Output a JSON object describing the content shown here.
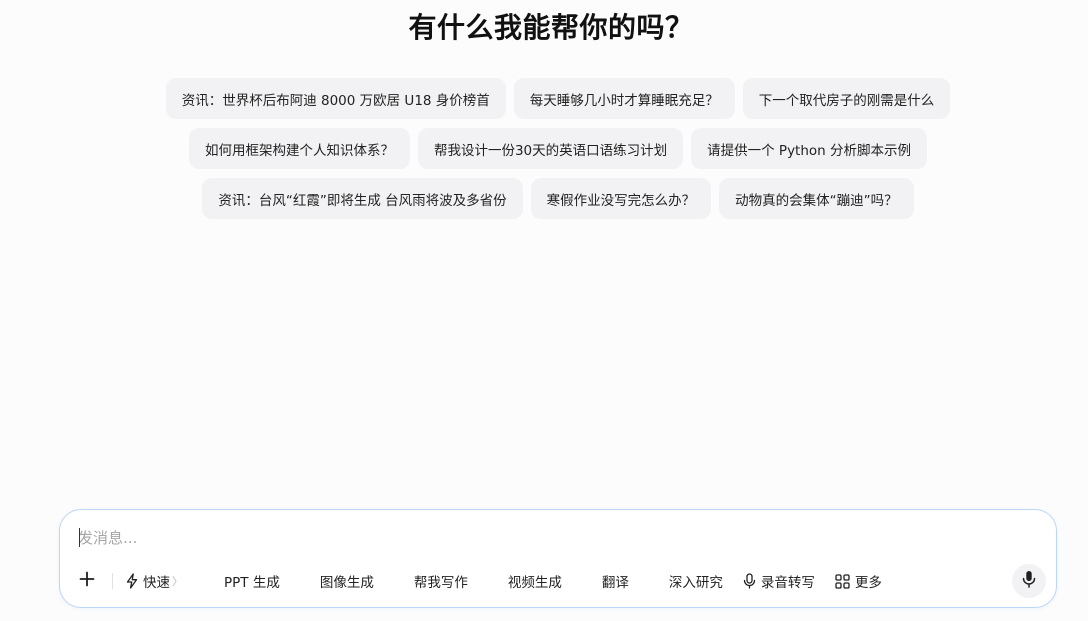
{
  "heading": "有什么我能帮你的吗？",
  "suggestions": {
    "row1": [
      "资讯：世界杯后布阿迪 8000 万欧居 U18 身价榜首",
      "每天睡够几小时才算睡眠充足？",
      "下一个取代房子的刚需是什么"
    ],
    "row2": [
      "如何用框架构建个人知识体系？",
      "帮我设计一份30天的英语口语练习计划",
      "请提供一个 Python 分析脚本示例"
    ],
    "row3": [
      "资讯：台风“红霞”即将生成 台风雨将波及多省份",
      "寒假作业没写完怎么办？",
      "动物真的会集体“蹦迪”吗？"
    ]
  },
  "composer": {
    "placeholder": "发消息...",
    "value": "",
    "mode_label": "快速",
    "mode_chevron": "〉",
    "tools": {
      "ppt": "PPT 生成",
      "image": "图像生成",
      "writing": "帮我写作",
      "video": "视频生成",
      "translate": "翻译",
      "research": "深入研究",
      "transcribe": "录音转写",
      "more": "更多"
    }
  },
  "icons": {
    "plus": "plus-icon",
    "mode": "lightning-icon",
    "transcribe": "microphone-icon",
    "more": "grid-icon",
    "voice": "microphone-icon"
  }
}
